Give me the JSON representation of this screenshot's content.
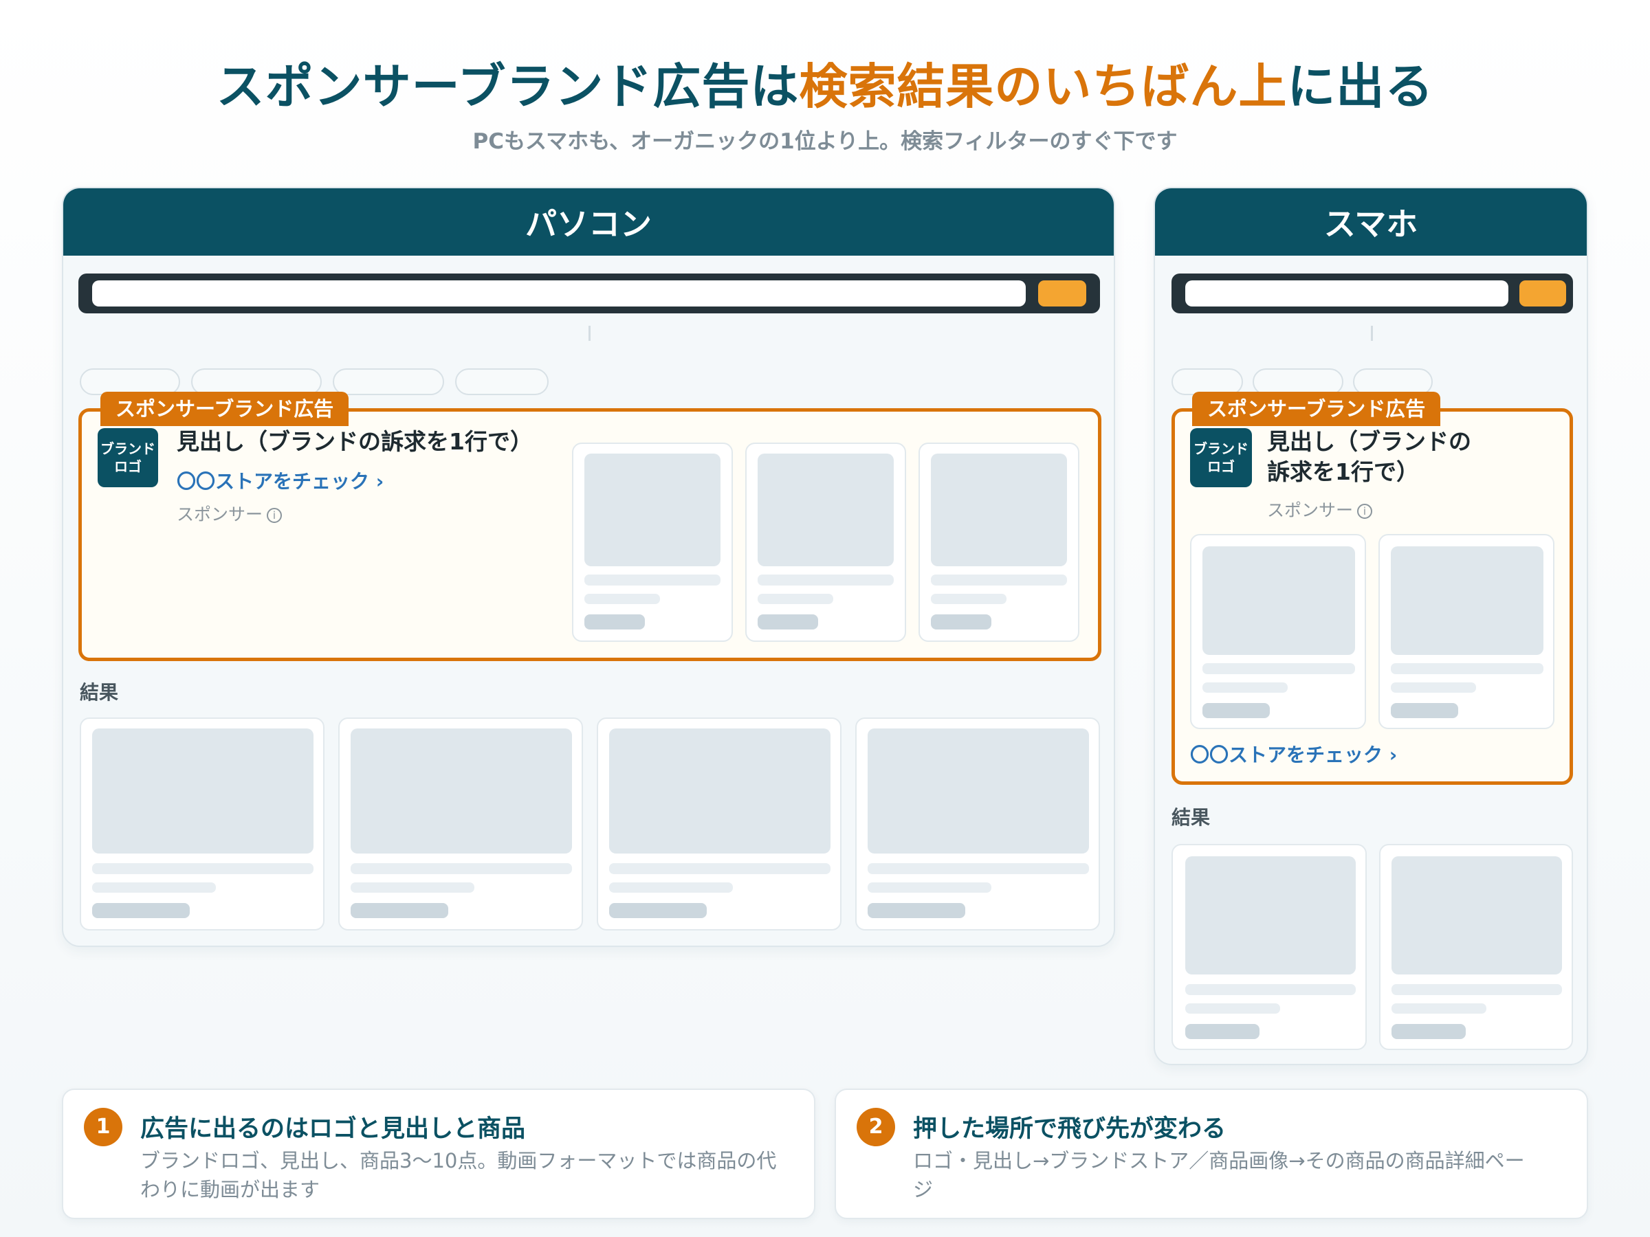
{
  "header": {
    "title_pre": "スポンサーブランド広告は",
    "title_highlight": "検索結果のいちばん上",
    "title_post": "に出る",
    "subtitle": "PCもスマホも、オーガニックの1位より上。検索フィルターのすぐ下です"
  },
  "desktop": {
    "title": "パソコン",
    "ad_tag": "スポンサーブランド広告",
    "logo_line1": "ブランド",
    "logo_line2": "ロゴ",
    "headline": "見出し（ブランドの訴求を1行で）",
    "store_link": "〇〇ストアをチェック ›",
    "sponsor": "スポンサー",
    "info_glyph": "i",
    "results_label": "結果"
  },
  "mobile": {
    "title": "スマホ",
    "ad_tag": "スポンサーブランド広告",
    "logo_line1": "ブランド",
    "logo_line2": "ロゴ",
    "headline_line1": "見出し（ブランドの",
    "headline_line2": "訴求を1行で）",
    "store_link": "〇〇ストアをチェック ›",
    "sponsor": "スポンサー",
    "info_glyph": "i",
    "results_label": "結果"
  },
  "notes": [
    {
      "number": "1",
      "title": "広告に出るのはロゴと見出しと商品",
      "body_line1": "ブランドロゴ、見出し、商品3〜10点。動画フォーマットでは商品の代",
      "body_line2": "わりに動画が出ます"
    },
    {
      "number": "2",
      "title": "押した場所で飛び先が変わる",
      "body_line1": "ロゴ・見出し→ブランドストア／商品画像→その商品の商品詳細ペー",
      "body_line2": "ジ"
    }
  ],
  "colors": {
    "primary": "#0b5163",
    "accent": "#d9740a",
    "search_button": "#f4a531",
    "link": "#2a73b8"
  }
}
